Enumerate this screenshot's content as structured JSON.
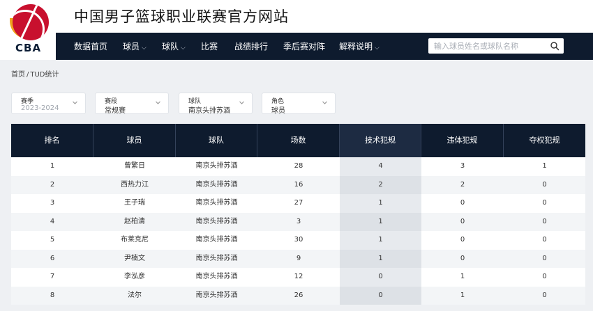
{
  "site": {
    "title": "中国男子篮球职业联赛官方网站",
    "logo_text": "CBA"
  },
  "nav": {
    "items": [
      {
        "label": "数据首页",
        "dropdown": false
      },
      {
        "label": "球员",
        "dropdown": true
      },
      {
        "label": "球队",
        "dropdown": true
      },
      {
        "label": "比赛",
        "dropdown": false
      },
      {
        "label": "战绩排行",
        "dropdown": false
      },
      {
        "label": "季后赛对阵",
        "dropdown": false
      },
      {
        "label": "解释说明",
        "dropdown": true
      }
    ],
    "chevron": "⌵",
    "search_placeholder": "输入球员姓名或球队名称",
    "search_value": ""
  },
  "breadcrumb": {
    "home": "首页",
    "sep": "/",
    "current": "TUD统计"
  },
  "filters": [
    {
      "label": "赛季",
      "value": "2023-2024",
      "muted": true
    },
    {
      "label": "赛段",
      "value": "常规赛",
      "muted": false
    },
    {
      "label": "球队",
      "value": "南京头排苏酒",
      "muted": false
    },
    {
      "label": "角色",
      "value": "球员",
      "muted": false
    }
  ],
  "table": {
    "columns": [
      "排名",
      "球员",
      "球队",
      "场数",
      "技术犯规",
      "违体犯规",
      "夺权犯规"
    ],
    "sorted_column": 4,
    "rows": [
      [
        "1",
        "曾繁日",
        "南京头排苏酒",
        "28",
        "4",
        "3",
        "1"
      ],
      [
        "2",
        "西热力江",
        "南京头排苏酒",
        "16",
        "2",
        "2",
        "0"
      ],
      [
        "3",
        "王子瑞",
        "南京头排苏酒",
        "27",
        "1",
        "0",
        "0"
      ],
      [
        "4",
        "赵柏清",
        "南京头排苏酒",
        "3",
        "1",
        "0",
        "0"
      ],
      [
        "5",
        "布莱克尼",
        "南京头排苏酒",
        "30",
        "1",
        "0",
        "0"
      ],
      [
        "6",
        "尹楠文",
        "南京头排苏酒",
        "9",
        "1",
        "0",
        "0"
      ],
      [
        "7",
        "李泓彦",
        "南京头排苏酒",
        "12",
        "0",
        "1",
        "0"
      ],
      [
        "8",
        "法尔",
        "南京头排苏酒",
        "26",
        "0",
        "1",
        "0"
      ]
    ]
  },
  "colors": {
    "nav_bg": "#0e1b2e",
    "brand_red": "#c8102e",
    "brand_orange": "#f0a51e"
  },
  "icons": {
    "search": "search-icon",
    "dropdown": "chevron-down-icon",
    "logo": "cba-logo"
  }
}
